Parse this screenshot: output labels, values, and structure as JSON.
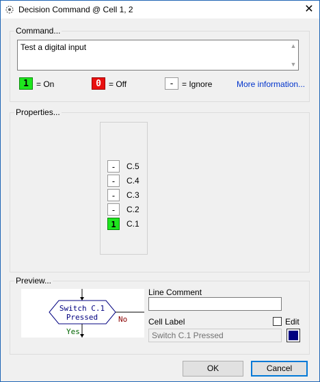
{
  "window": {
    "title": "Decision Command @ Cell 1, 2",
    "close_glyph": "✕"
  },
  "command": {
    "group_label": "Command...",
    "text": "Test a digital input",
    "legend": {
      "on_chip": "1",
      "on_label": "= On",
      "off_chip": "0",
      "off_label": "= Off",
      "ignore_chip": "-",
      "ignore_label": "= Ignore",
      "more_info": "More information..."
    }
  },
  "properties": {
    "group_label": "Properties...",
    "bits": [
      {
        "value": "-",
        "label": "C.5",
        "state": "ignore"
      },
      {
        "value": "-",
        "label": "C.4",
        "state": "ignore"
      },
      {
        "value": "-",
        "label": "C.3",
        "state": "ignore"
      },
      {
        "value": "-",
        "label": "C.2",
        "state": "ignore"
      },
      {
        "value": "1",
        "label": "C.1",
        "state": "on"
      }
    ]
  },
  "preview": {
    "group_label": "Preview...",
    "shape_text_line1": "Switch C.1",
    "shape_text_line2": "Pressed",
    "no_label": "No",
    "yes_label": "Yes",
    "line_comment_label": "Line Comment",
    "line_comment_value": "",
    "cell_label_label": "Cell Label",
    "edit_label": "Edit",
    "cell_label_value": "Switch C.1 Pressed",
    "colors": {
      "on": "#1ee61e",
      "off": "#e81010",
      "flow_line": "#000080",
      "no": "#8b0000",
      "yes": "#006400",
      "cell_color": "#000080"
    }
  },
  "buttons": {
    "ok": "OK",
    "cancel": "Cancel"
  }
}
